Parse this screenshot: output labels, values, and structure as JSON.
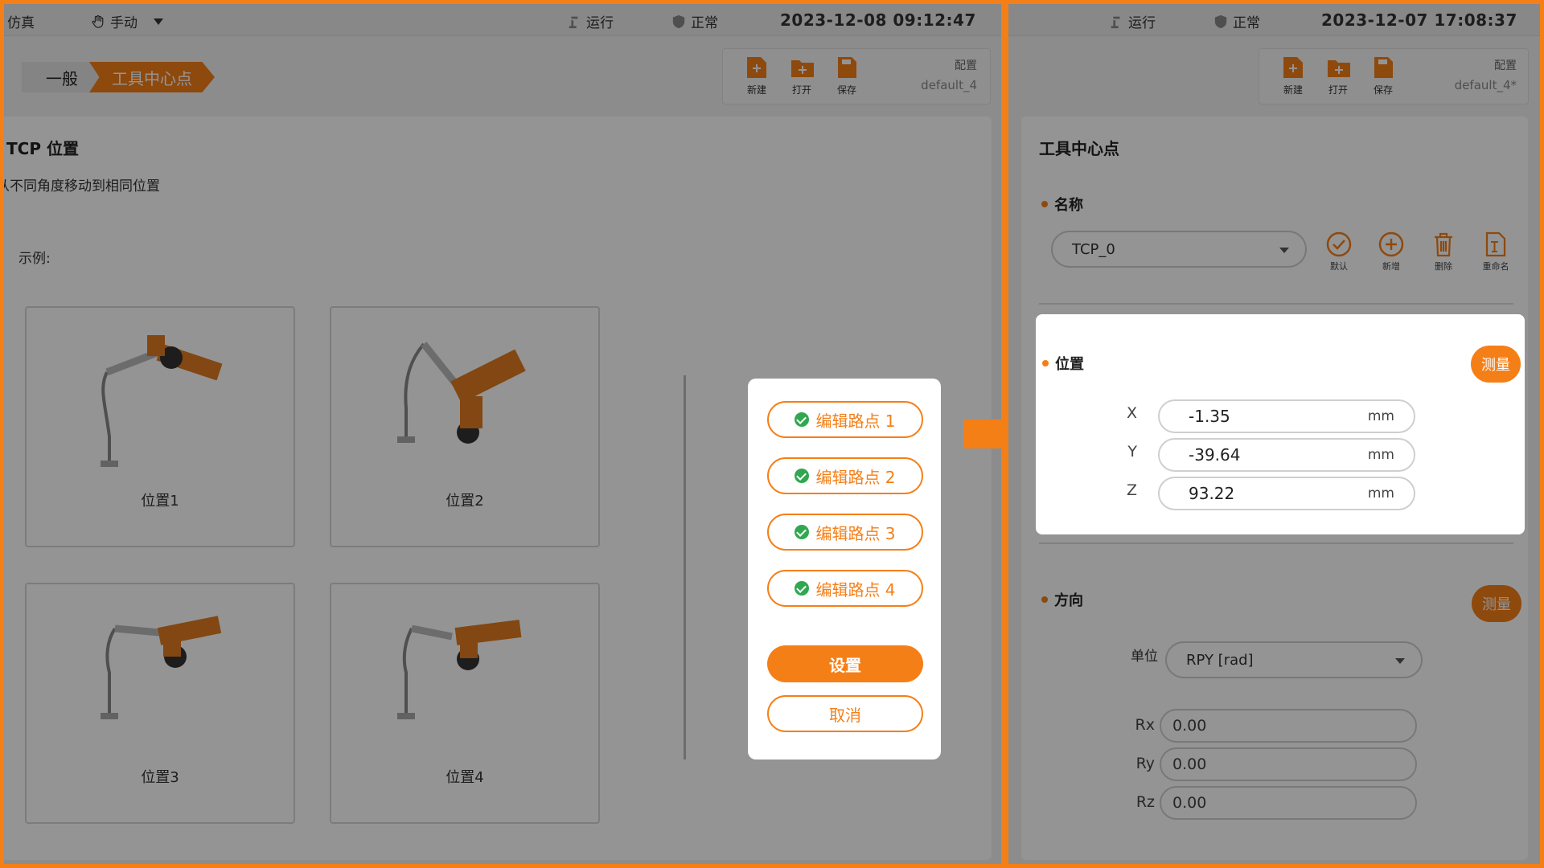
{
  "left": {
    "status": {
      "sim": "仿真",
      "mode": "手动",
      "run": "运行",
      "safety": "正常",
      "datetime": "2023-12-08 09:12:47"
    },
    "breadcrumb": {
      "general": "一般",
      "tcp": "工具中心点"
    },
    "toolbar": {
      "new": "新建",
      "open": "打开",
      "save": "保存",
      "config_label": "配置",
      "config_value": "default_4"
    },
    "content": {
      "title": "TCP 位置",
      "description": "从不同角度移动到相同位置",
      "example_label": "示例:",
      "positions": [
        "位置1",
        "位置2",
        "位置3",
        "位置4"
      ]
    },
    "dialog": {
      "waypoints": [
        "编辑路点 1",
        "编辑路点 2",
        "编辑路点 3",
        "编辑路点 4"
      ],
      "set": "设置",
      "cancel": "取消"
    }
  },
  "right": {
    "status": {
      "run": "运行",
      "safety": "正常",
      "datetime": "2023-12-07 17:08:37"
    },
    "toolbar": {
      "new": "新建",
      "open": "打开",
      "save": "保存",
      "config_label": "配置",
      "config_value": "default_4*"
    },
    "title": "工具中心点",
    "name_section": {
      "label": "名称",
      "selected": "TCP_0",
      "actions": {
        "default": "默认",
        "new": "新增",
        "delete": "删除",
        "rename": "重命名"
      }
    },
    "position": {
      "label": "位置",
      "measure": "测量",
      "fields": [
        {
          "axis": "X",
          "value": "-1.35",
          "unit": "mm"
        },
        {
          "axis": "Y",
          "value": "-39.64",
          "unit": "mm"
        },
        {
          "axis": "Z",
          "value": "93.22",
          "unit": "mm"
        }
      ]
    },
    "orientation": {
      "label": "方向",
      "measure": "测量",
      "unit_label": "单位",
      "unit_selected": "RPY [rad]",
      "fields": [
        {
          "axis": "Rx",
          "value": "0.00"
        },
        {
          "axis": "Ry",
          "value": "0.00"
        },
        {
          "axis": "Rz",
          "value": "0.00"
        }
      ]
    }
  },
  "colors": {
    "accent": "#f57f17",
    "check": "#2fa84f"
  }
}
